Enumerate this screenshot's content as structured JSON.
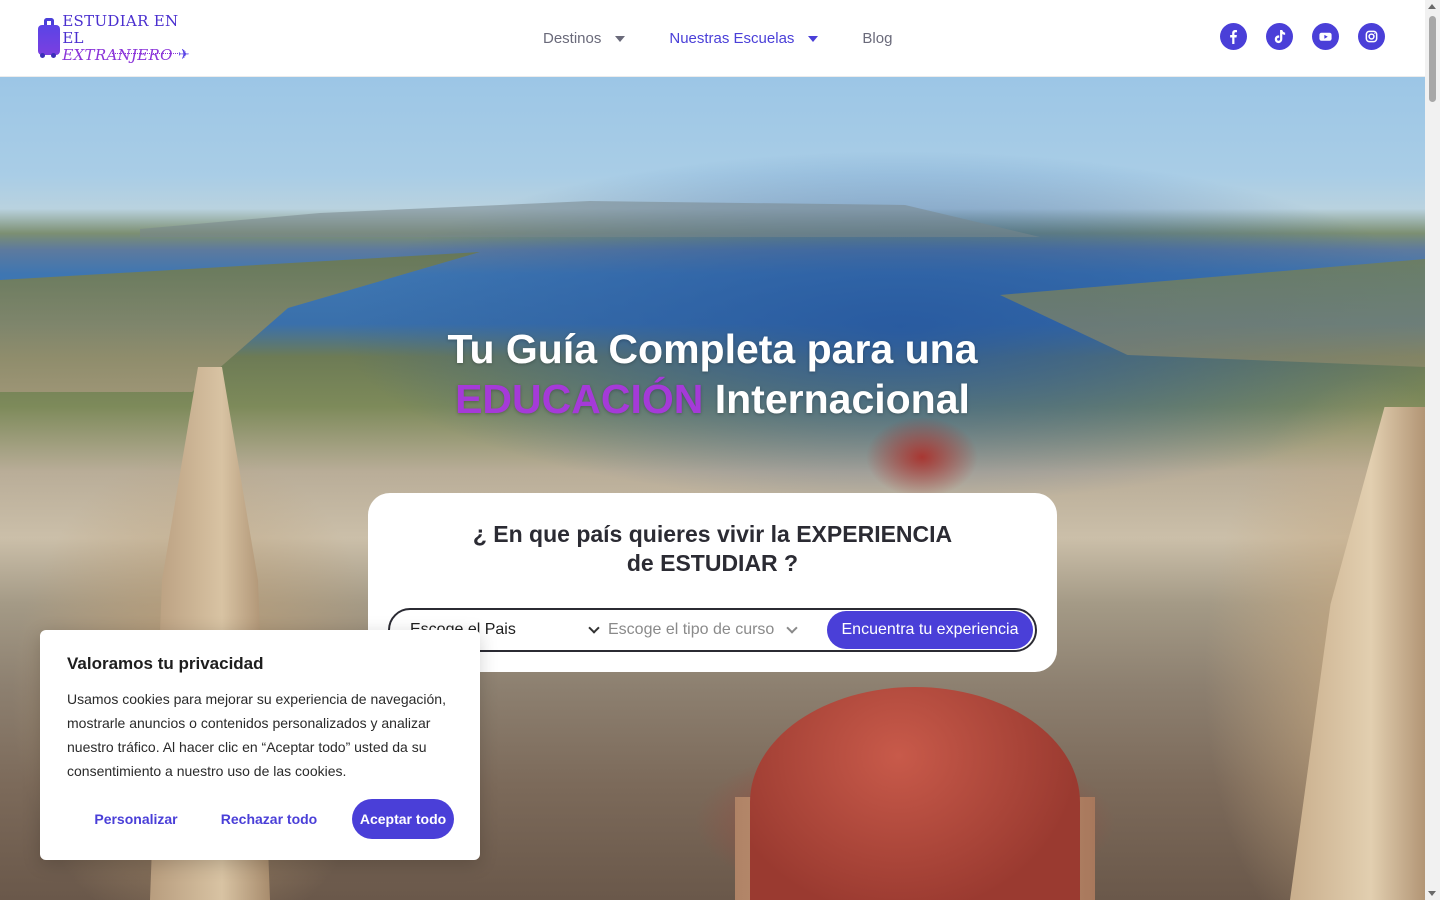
{
  "logo": {
    "line1": "ESTUDIAR EN EL",
    "line2": "EXTRANJERO",
    "plane_icon": "airplane-icon",
    "suitcase_icon": "suitcase-icon"
  },
  "nav": {
    "items": [
      {
        "label": "Destinos",
        "has_dropdown": true
      },
      {
        "label": "Nuestras Escuelas",
        "has_dropdown": true,
        "active": true
      },
      {
        "label": "Blog",
        "has_dropdown": false
      }
    ]
  },
  "socials": [
    {
      "name": "facebook-icon"
    },
    {
      "name": "tiktok-icon"
    },
    {
      "name": "youtube-icon"
    },
    {
      "name": "instagram-icon"
    }
  ],
  "hero": {
    "title_line1": "Tu Guía Completa para una",
    "title_accent": "EDUCACIÓN",
    "title_rest": " Internacional"
  },
  "search": {
    "heading_line1": "¿ En que país quieres vivir la EXPERIENCIA",
    "heading_line2": "de ESTUDIAR ?",
    "country_select": "Escoge el Pais",
    "course_select": "Escoge el tipo de curso",
    "button": "Encuentra tu experiencia"
  },
  "cookie": {
    "title": "Valoramos tu privacidad",
    "text": "Usamos cookies para mejorar su experiencia de navegación, mostrarle anuncios o contenidos personalizados y analizar nuestro tráfico. Al hacer clic en “Aceptar todo” usted da su consentimiento a nuestro uso de las cookies.",
    "customize": "Personalizar",
    "reject": "Rechazar todo",
    "accept": "Aceptar todo"
  },
  "colors": {
    "accent": "#4a3fd8",
    "title_accent": "#a53ad8"
  }
}
